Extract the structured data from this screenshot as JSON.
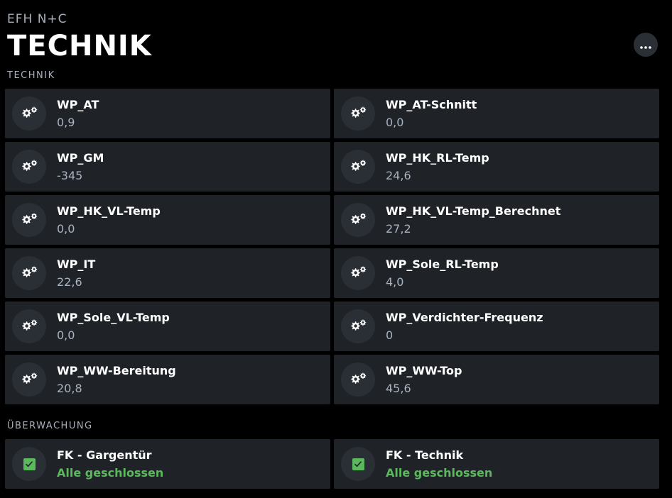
{
  "header": {
    "breadcrumb": "EFH N+C",
    "title": "TECHNIK",
    "more_icon": "more-horizontal-icon"
  },
  "sections": [
    {
      "label": "TECHNIK",
      "tiles": [
        {
          "name": "WP_AT",
          "value": "0,9",
          "icon": "gear-icon"
        },
        {
          "name": "WP_AT-Schnitt",
          "value": "0,0",
          "icon": "gear-icon"
        },
        {
          "name": "WP_GM",
          "value": "-345",
          "icon": "gear-icon"
        },
        {
          "name": "WP_HK_RL-Temp",
          "value": "24,6",
          "icon": "gear-icon"
        },
        {
          "name": "WP_HK_VL-Temp",
          "value": "0,0",
          "icon": "gear-icon"
        },
        {
          "name": "WP_HK_VL-Temp_Berechnet",
          "value": "27,2",
          "icon": "gear-icon"
        },
        {
          "name": "WP_IT",
          "value": "22,6",
          "icon": "gear-icon"
        },
        {
          "name": "WP_Sole_RL-Temp",
          "value": "4,0",
          "icon": "gear-icon"
        },
        {
          "name": "WP_Sole_VL-Temp",
          "value": "0,0",
          "icon": "gear-icon"
        },
        {
          "name": "WP_Verdichter-Frequenz",
          "value": "0",
          "icon": "gear-icon"
        },
        {
          "name": "WP_WW-Bereitung",
          "value": "20,8",
          "icon": "gear-icon"
        },
        {
          "name": "WP_WW-Top",
          "value": "45,6",
          "icon": "gear-icon"
        }
      ]
    },
    {
      "label": "ÜBERWACHUNG",
      "tiles": [
        {
          "name": "FK - Gargentür",
          "value": "Alle geschlossen",
          "icon": "checkbox-checked-icon"
        },
        {
          "name": "FK - Technik",
          "value": "Alle geschlossen",
          "icon": "checkbox-checked-icon"
        }
      ]
    }
  ],
  "colors": {
    "background": "#000000",
    "tile": "#1f2328",
    "icon_circle": "#2a2f36",
    "value_text": "#a9b4c2",
    "ok_green": "#5cb85c"
  }
}
